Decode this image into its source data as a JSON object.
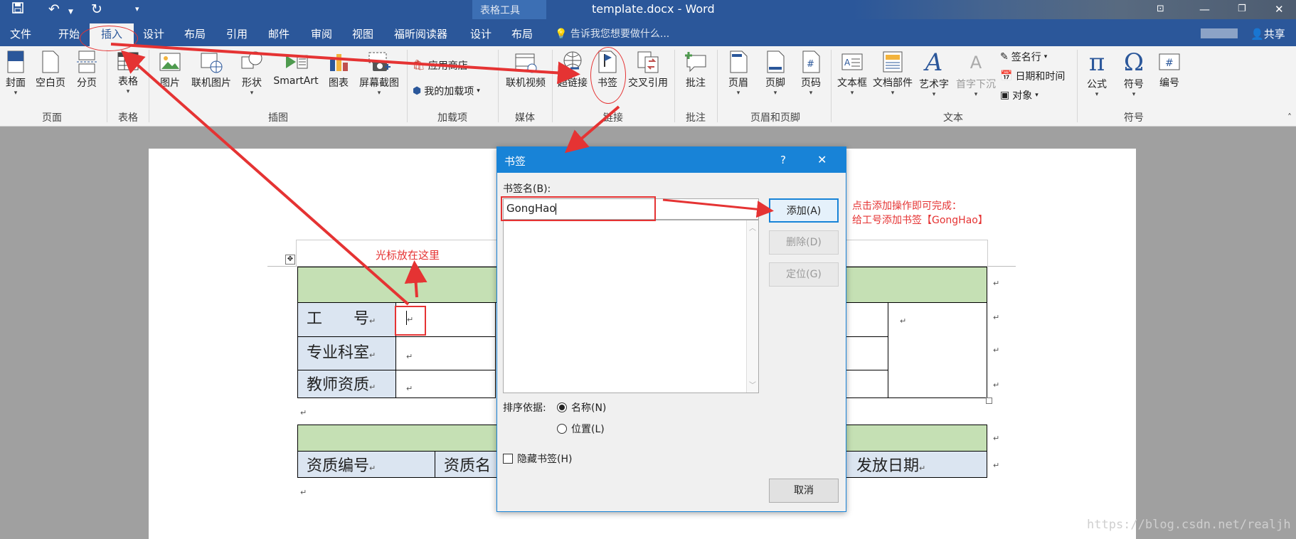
{
  "titlebar": {
    "context_tools": "表格工具",
    "doc_title": "template.docx - Word"
  },
  "tabs": {
    "file": "文件",
    "home": "开始",
    "insert": "插入",
    "design": "设计",
    "layout": "布局",
    "references": "引用",
    "mailings": "邮件",
    "review": "审阅",
    "view": "视图",
    "foxit": "福昕阅读器",
    "table_design": "设计",
    "table_layout": "布局",
    "tell_me": "告诉我您想要做什么...",
    "share": "共享"
  },
  "ribbon": {
    "cover": "封面",
    "blank_page": "空白页",
    "page_break": "分页",
    "table": "表格",
    "picture": "图片",
    "online_picture": "联机图片",
    "shapes": "形状",
    "smartart": "SmartArt",
    "chart": "图表",
    "screenshot": "屏幕截图",
    "store": "应用商店",
    "my_addins": "我的加载项",
    "online_video": "联机视频",
    "hyperlink": "超链接",
    "bookmark": "书签",
    "cross_ref": "交叉引用",
    "comment": "批注",
    "header": "页眉",
    "footer": "页脚",
    "page_number": "页码",
    "textbox": "文本框",
    "quick_parts": "文档部件",
    "wordart": "艺术字",
    "dropcap": "首字下沉",
    "signature": "签名行",
    "datetime": "日期和时间",
    "object": "对象",
    "equation": "公式",
    "symbol": "符号",
    "numbering": "编号",
    "groups": {
      "pages": "页面",
      "tables": "表格",
      "illustrations": "插图",
      "addins": "加载项",
      "media": "媒体",
      "links": "链接",
      "comments": "批注",
      "header_footer": "页眉和页脚",
      "text": "文本",
      "symbols": "符号"
    }
  },
  "document": {
    "row_gonghao": "工　　号",
    "row_major": "专业科室",
    "row_teacher": "教师资质",
    "col_qual_no": "资质编号",
    "col_qual_name": "资质名",
    "col_issue_date": "发放日期"
  },
  "dialog": {
    "title": "书签",
    "help": "?",
    "close": "✕",
    "name_label": "书签名(B):",
    "name_value": "GongHao",
    "add": "添加(A)",
    "delete": "删除(D)",
    "goto": "定位(G)",
    "sort_label": "排序依据:",
    "sort_name": "名称(N)",
    "sort_location": "位置(L)",
    "hidden": "隐藏书签(H)",
    "cancel": "取消"
  },
  "annotations": {
    "cursor_here": "光标放在这里",
    "add_line1": "点击添加操作即可完成：",
    "add_line2": "给工号添加书签【GongHao】"
  },
  "watermark": "https://blog.csdn.net/realjh",
  "colors": {
    "word_blue": "#2b579a",
    "dialog_blue": "#1883d7",
    "annotation_red": "#e53333",
    "table_green": "#c5e0b4",
    "table_blue": "#dbe5f1"
  }
}
